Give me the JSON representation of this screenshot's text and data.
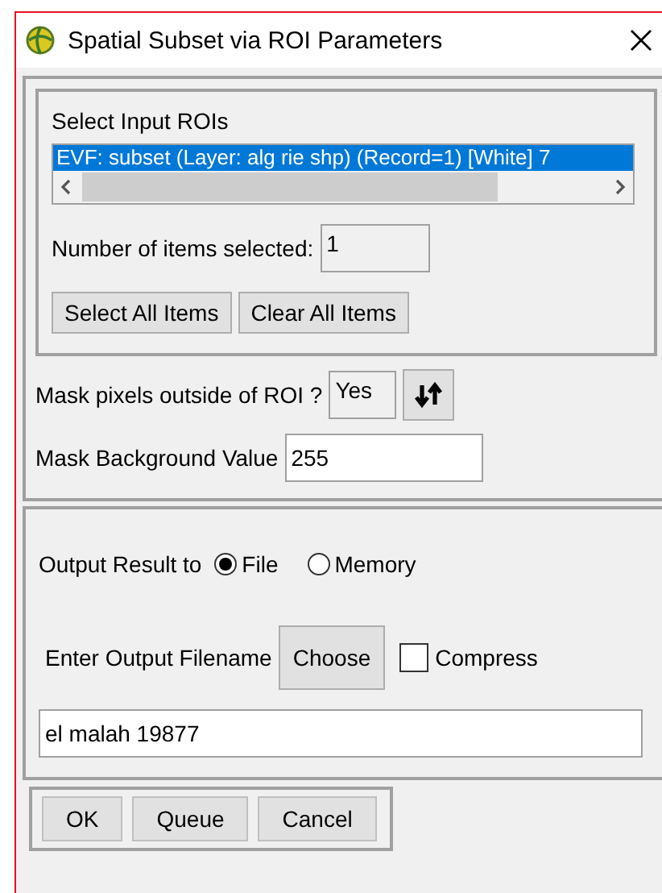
{
  "window": {
    "title": "Spatial Subset via ROI Parameters"
  },
  "roi_list": {
    "label": "Select Input ROIs",
    "items": [
      {
        "text": "EVF: subset (Layer: alg rie shp) (Record=1) [White] 7",
        "selected": true
      }
    ]
  },
  "items_selected": {
    "label": "Number of items selected:",
    "value": "1"
  },
  "roi_buttons": [
    "Select All Items",
    "Clear All Items"
  ],
  "mask_pixels": {
    "label": "Mask pixels outside of ROI ?",
    "value": "Yes"
  },
  "mask_background": {
    "label": "Mask Background Value",
    "value": "255"
  },
  "output": {
    "label": "Output Result to",
    "options": [
      {
        "label": "File",
        "selected": true
      },
      {
        "label": "Memory",
        "selected": false
      }
    ]
  },
  "filename": {
    "label": "Enter Output Filename",
    "button": "Choose",
    "compress": {
      "label": "Compress",
      "checked": false
    },
    "value": "el malah 19877"
  },
  "buttons": [
    "OK",
    "Queue",
    "Cancel"
  ]
}
